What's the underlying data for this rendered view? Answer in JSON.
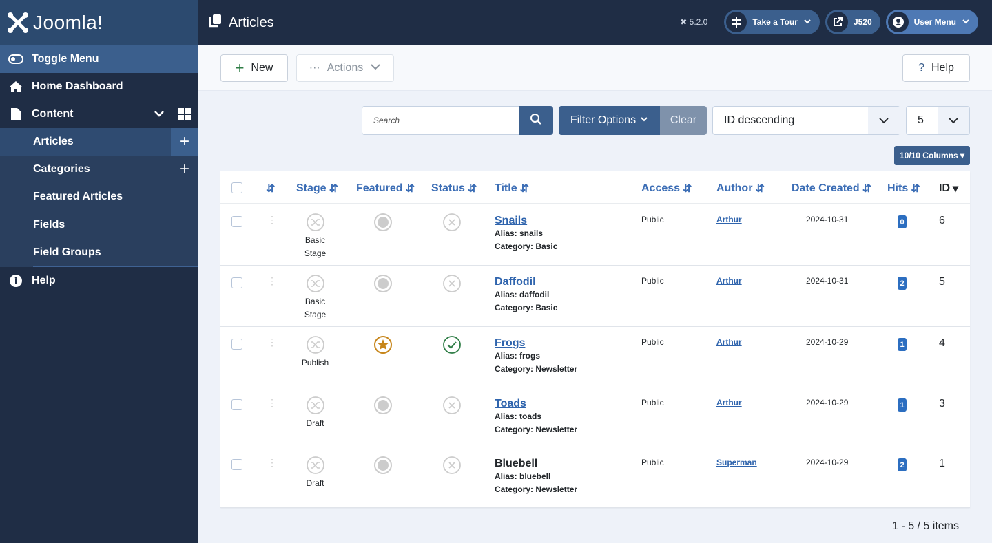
{
  "brand": {
    "name": "Joomla!"
  },
  "sidebar": {
    "toggle": "Toggle Menu",
    "home": "Home Dashboard",
    "content": "Content",
    "sub": [
      {
        "label": "Articles",
        "plus": "+"
      },
      {
        "label": "Categories",
        "plus": "+"
      },
      {
        "label": "Featured Articles"
      },
      {
        "label": "Fields"
      },
      {
        "label": "Field Groups"
      }
    ],
    "help": "Help"
  },
  "header": {
    "title": "Articles",
    "version": "5.2.0",
    "tour": "Take a Tour",
    "site": "J520",
    "user": "User Menu"
  },
  "toolbar": {
    "new": "New",
    "actions": "Actions",
    "help": "Help"
  },
  "filters": {
    "search_placeholder": "Search",
    "filter_options": "Filter Options",
    "clear": "Clear",
    "ordering": "ID descending",
    "limit": "5",
    "columns": "10/10 Columns"
  },
  "table": {
    "headers": {
      "stage": "Stage",
      "featured": "Featured",
      "status": "Status",
      "title": "Title",
      "access": "Access",
      "author": "Author",
      "date": "Date Created",
      "hits": "Hits",
      "id": "ID"
    },
    "rows": [
      {
        "stage": "Basic Stage",
        "featured": false,
        "published": false,
        "title": "Snails",
        "linked": true,
        "alias": "Alias: snails",
        "category": "Category: Basic",
        "access": "Public",
        "author": "Arthur",
        "date": "2024-10-31",
        "hits": "0",
        "id": "6"
      },
      {
        "stage": "Basic Stage",
        "featured": false,
        "published": false,
        "title": "Daffodil",
        "linked": true,
        "alias": "Alias: daffodil",
        "category": "Category: Basic",
        "access": "Public",
        "author": "Arthur",
        "date": "2024-10-31",
        "hits": "2",
        "id": "5"
      },
      {
        "stage": "Publish",
        "featured": true,
        "published": true,
        "title": "Frogs",
        "linked": true,
        "alias": "Alias: frogs",
        "category": "Category: Newsletter",
        "access": "Public",
        "author": "Arthur",
        "date": "2024-10-29",
        "hits": "1",
        "id": "4"
      },
      {
        "stage": "Draft",
        "featured": false,
        "published": false,
        "title": "Toads",
        "linked": true,
        "alias": "Alias: toads",
        "category": "Category: Newsletter",
        "access": "Public",
        "author": "Arthur",
        "date": "2024-10-29",
        "hits": "1",
        "id": "3"
      },
      {
        "stage": "Draft",
        "featured": false,
        "published": false,
        "title": "Bluebell",
        "linked": false,
        "alias": "Alias: bluebell",
        "category": "Category: Newsletter",
        "access": "Public",
        "author": "Superman",
        "date": "2024-10-29",
        "hits": "2",
        "id": "1"
      }
    ]
  },
  "pagination": {
    "summary": "1 - 5 / 5 items"
  },
  "colors": {
    "sidebar": "#1f2d45",
    "accent": "#3b5f8d",
    "link": "#2f64ad",
    "featured": "#c7861b",
    "published": "#2f7d46"
  }
}
